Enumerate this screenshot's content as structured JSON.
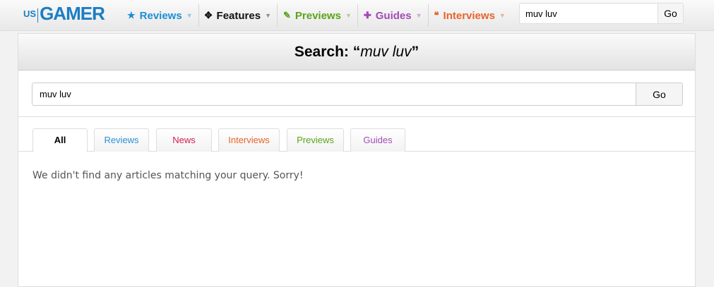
{
  "logo": {
    "us": "US",
    "gamer": "GAMER"
  },
  "nav": [
    {
      "label": "Reviews",
      "icon": "★",
      "color": "#1a8fd6"
    },
    {
      "label": "Features",
      "icon": "✥",
      "color": "#111111"
    },
    {
      "label": "Previews",
      "icon": "✎",
      "color": "#5aa51a"
    },
    {
      "label": "Guides",
      "icon": "✚",
      "color": "#a24bb5"
    },
    {
      "label": "Interviews",
      "icon": "❝",
      "color": "#e8632a"
    }
  ],
  "top_search": {
    "value": "muv luv",
    "button": "Go"
  },
  "page": {
    "title_prefix": "Search: “",
    "query": "muv luv",
    "title_suffix": "”"
  },
  "search": {
    "value": "muv luv",
    "button": "Go"
  },
  "tabs": [
    {
      "label": "All",
      "color": "#000000"
    },
    {
      "label": "Reviews",
      "color": "#2b8fd6"
    },
    {
      "label": "News",
      "color": "#d3204f"
    },
    {
      "label": "Interviews",
      "color": "#e8632a"
    },
    {
      "label": "Previews",
      "color": "#5aa51a"
    },
    {
      "label": "Guides",
      "color": "#a24bb5"
    }
  ],
  "message": "We didn't find any articles matching your query. Sorry!"
}
